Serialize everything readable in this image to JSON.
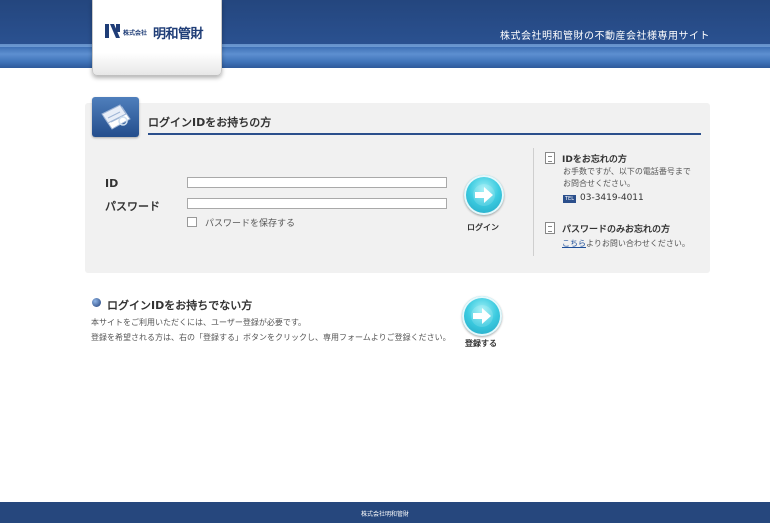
{
  "header": {
    "tagline": "株式会社明和管財の不動産会社様専用サイト",
    "logo_small": "株式会社",
    "logo_big": "明和管財"
  },
  "login": {
    "title": "ログインIDをお持ちの方",
    "id_label": "ID",
    "password_label": "パスワード",
    "id_value": "",
    "password_value": "",
    "remember_label": "パスワードを保存する",
    "button_label": "ログイン"
  },
  "aside": {
    "forgot_id_title": "IDをお忘れの方",
    "forgot_id_text_1": "お手数ですが、以下の電話番号まで",
    "forgot_id_text_2": "お問合せください。",
    "tel_badge": "TEL",
    "tel_number": "03-3419-4011",
    "forgot_pw_title": "パスワードのみお忘れの方",
    "forgot_pw_link": "こちら",
    "forgot_pw_text": "よりお問い合わせください。"
  },
  "register": {
    "title": "ログインIDをお持ちでない方",
    "text_1": "本サイトをご利用いただくには、ユーザー登録が必要です。",
    "text_2": "登録を希望される方は、右の「登録する」ボタンをクリックし、専用フォームよりご登録ください。",
    "button_label": "登録する"
  },
  "footer": {
    "text": "株式会社明和管財"
  },
  "icons": {
    "logo": "logo-mark-icon",
    "panel": "documents-icon",
    "arrow": "arrow-right-icon",
    "doc": "document-icon",
    "bullet": "bullet-icon"
  }
}
